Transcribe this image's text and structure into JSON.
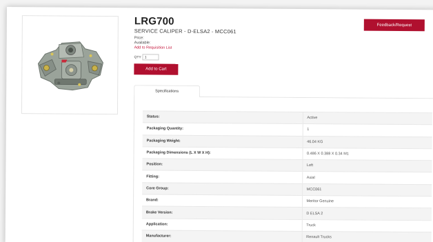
{
  "product": {
    "sku": "LRG700",
    "title": "SERVICE CALIPER - D-ELSA2 - MCC061",
    "price_label": "Price:",
    "available_label": "Available:",
    "requisition_link": "Add to Requisition List",
    "qty_label": "QTY",
    "qty_value": "1",
    "add_to_cart_label": "Add to Cart"
  },
  "feedback_label": "Feedback/Request",
  "tabs": [
    {
      "label": "Specifications"
    }
  ],
  "specs": [
    {
      "label": "Status:",
      "value": "Active"
    },
    {
      "label": "Packaging Quantity:",
      "value": "1"
    },
    {
      "label": "Packaging Weight:",
      "value": "46.04 KG"
    },
    {
      "label": "Packaging Dimensions (L X W X H):",
      "value": "0.486 X 0.388 X 0.34 M1"
    },
    {
      "label": "Position:",
      "value": "Left"
    },
    {
      "label": "Fitting:",
      "value": "Axial"
    },
    {
      "label": "Core Group:",
      "value": "MCC061"
    },
    {
      "label": "Brand:",
      "value": "Meritor Genuine"
    },
    {
      "label": "Brake Version:",
      "value": "D ELSA 2"
    },
    {
      "label": "Application:",
      "value": "Truck"
    },
    {
      "label": "Manufacturer:",
      "value": "Renault Trucks"
    }
  ],
  "colors": {
    "accent": "#b0102f",
    "link": "#c4153a"
  },
  "icons": {
    "product_image": "brake-caliper-image"
  }
}
